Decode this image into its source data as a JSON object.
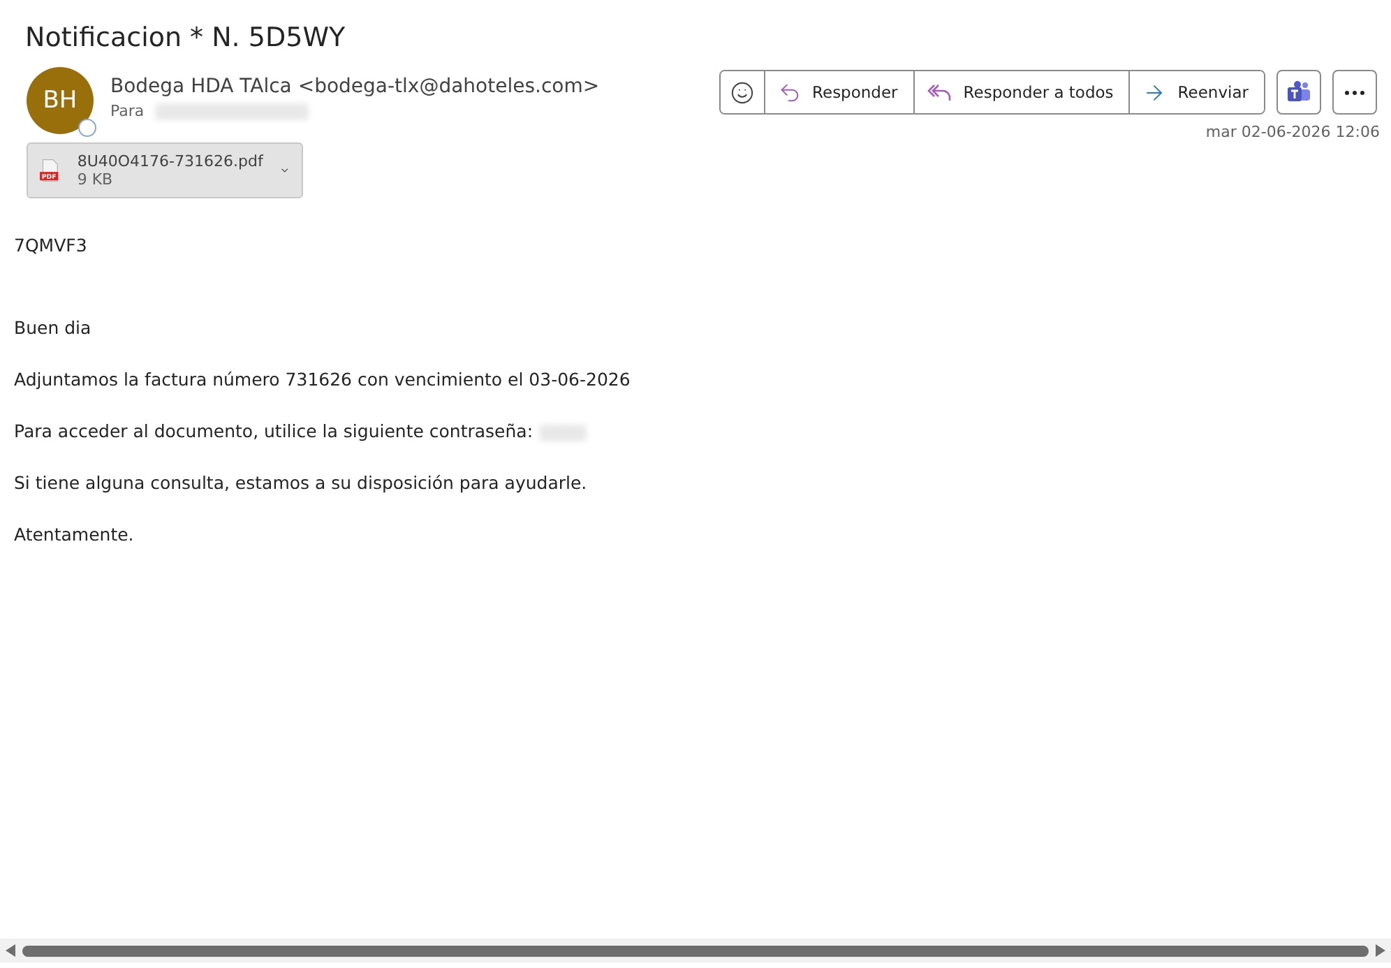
{
  "subject": "Notificacion * N. 5D5WY",
  "sender": {
    "initials": "BH",
    "name": "Bodega HDA TAlca <bodega-tlx@dahoteles.com>",
    "to_label": "Para",
    "presence_ring": true
  },
  "actions": [
    {
      "kind": "react"
    },
    {
      "kind": "reply",
      "label": "Responder"
    },
    {
      "kind": "reply_all",
      "label": "Responder a todos"
    },
    {
      "kind": "forward",
      "label": "Reenviar"
    }
  ],
  "extra_actions": [
    {
      "kind": "teams"
    },
    {
      "kind": "more"
    }
  ],
  "date": "mar 02-06-2026 12:06",
  "attachment": {
    "name": "8U40O4176-731626.pdf",
    "size": "9 KB",
    "type_label": "PDF"
  },
  "body": [
    {
      "kind": "code",
      "text": "7QMVF3"
    },
    {
      "kind": "gap"
    },
    {
      "kind": "text",
      "text": "Buen dia"
    },
    {
      "kind": "text",
      "text": "Adjuntamos la factura número 731626 con vencimiento el 03-06-2026"
    },
    {
      "kind": "redacted",
      "text": "Para acceder al documento, utilice la siguiente contraseña:"
    },
    {
      "kind": "text",
      "text": "Si tiene alguna consulta, estamos a su disposición para ayudarle."
    },
    {
      "kind": "text",
      "text": "Atentamente."
    }
  ]
}
